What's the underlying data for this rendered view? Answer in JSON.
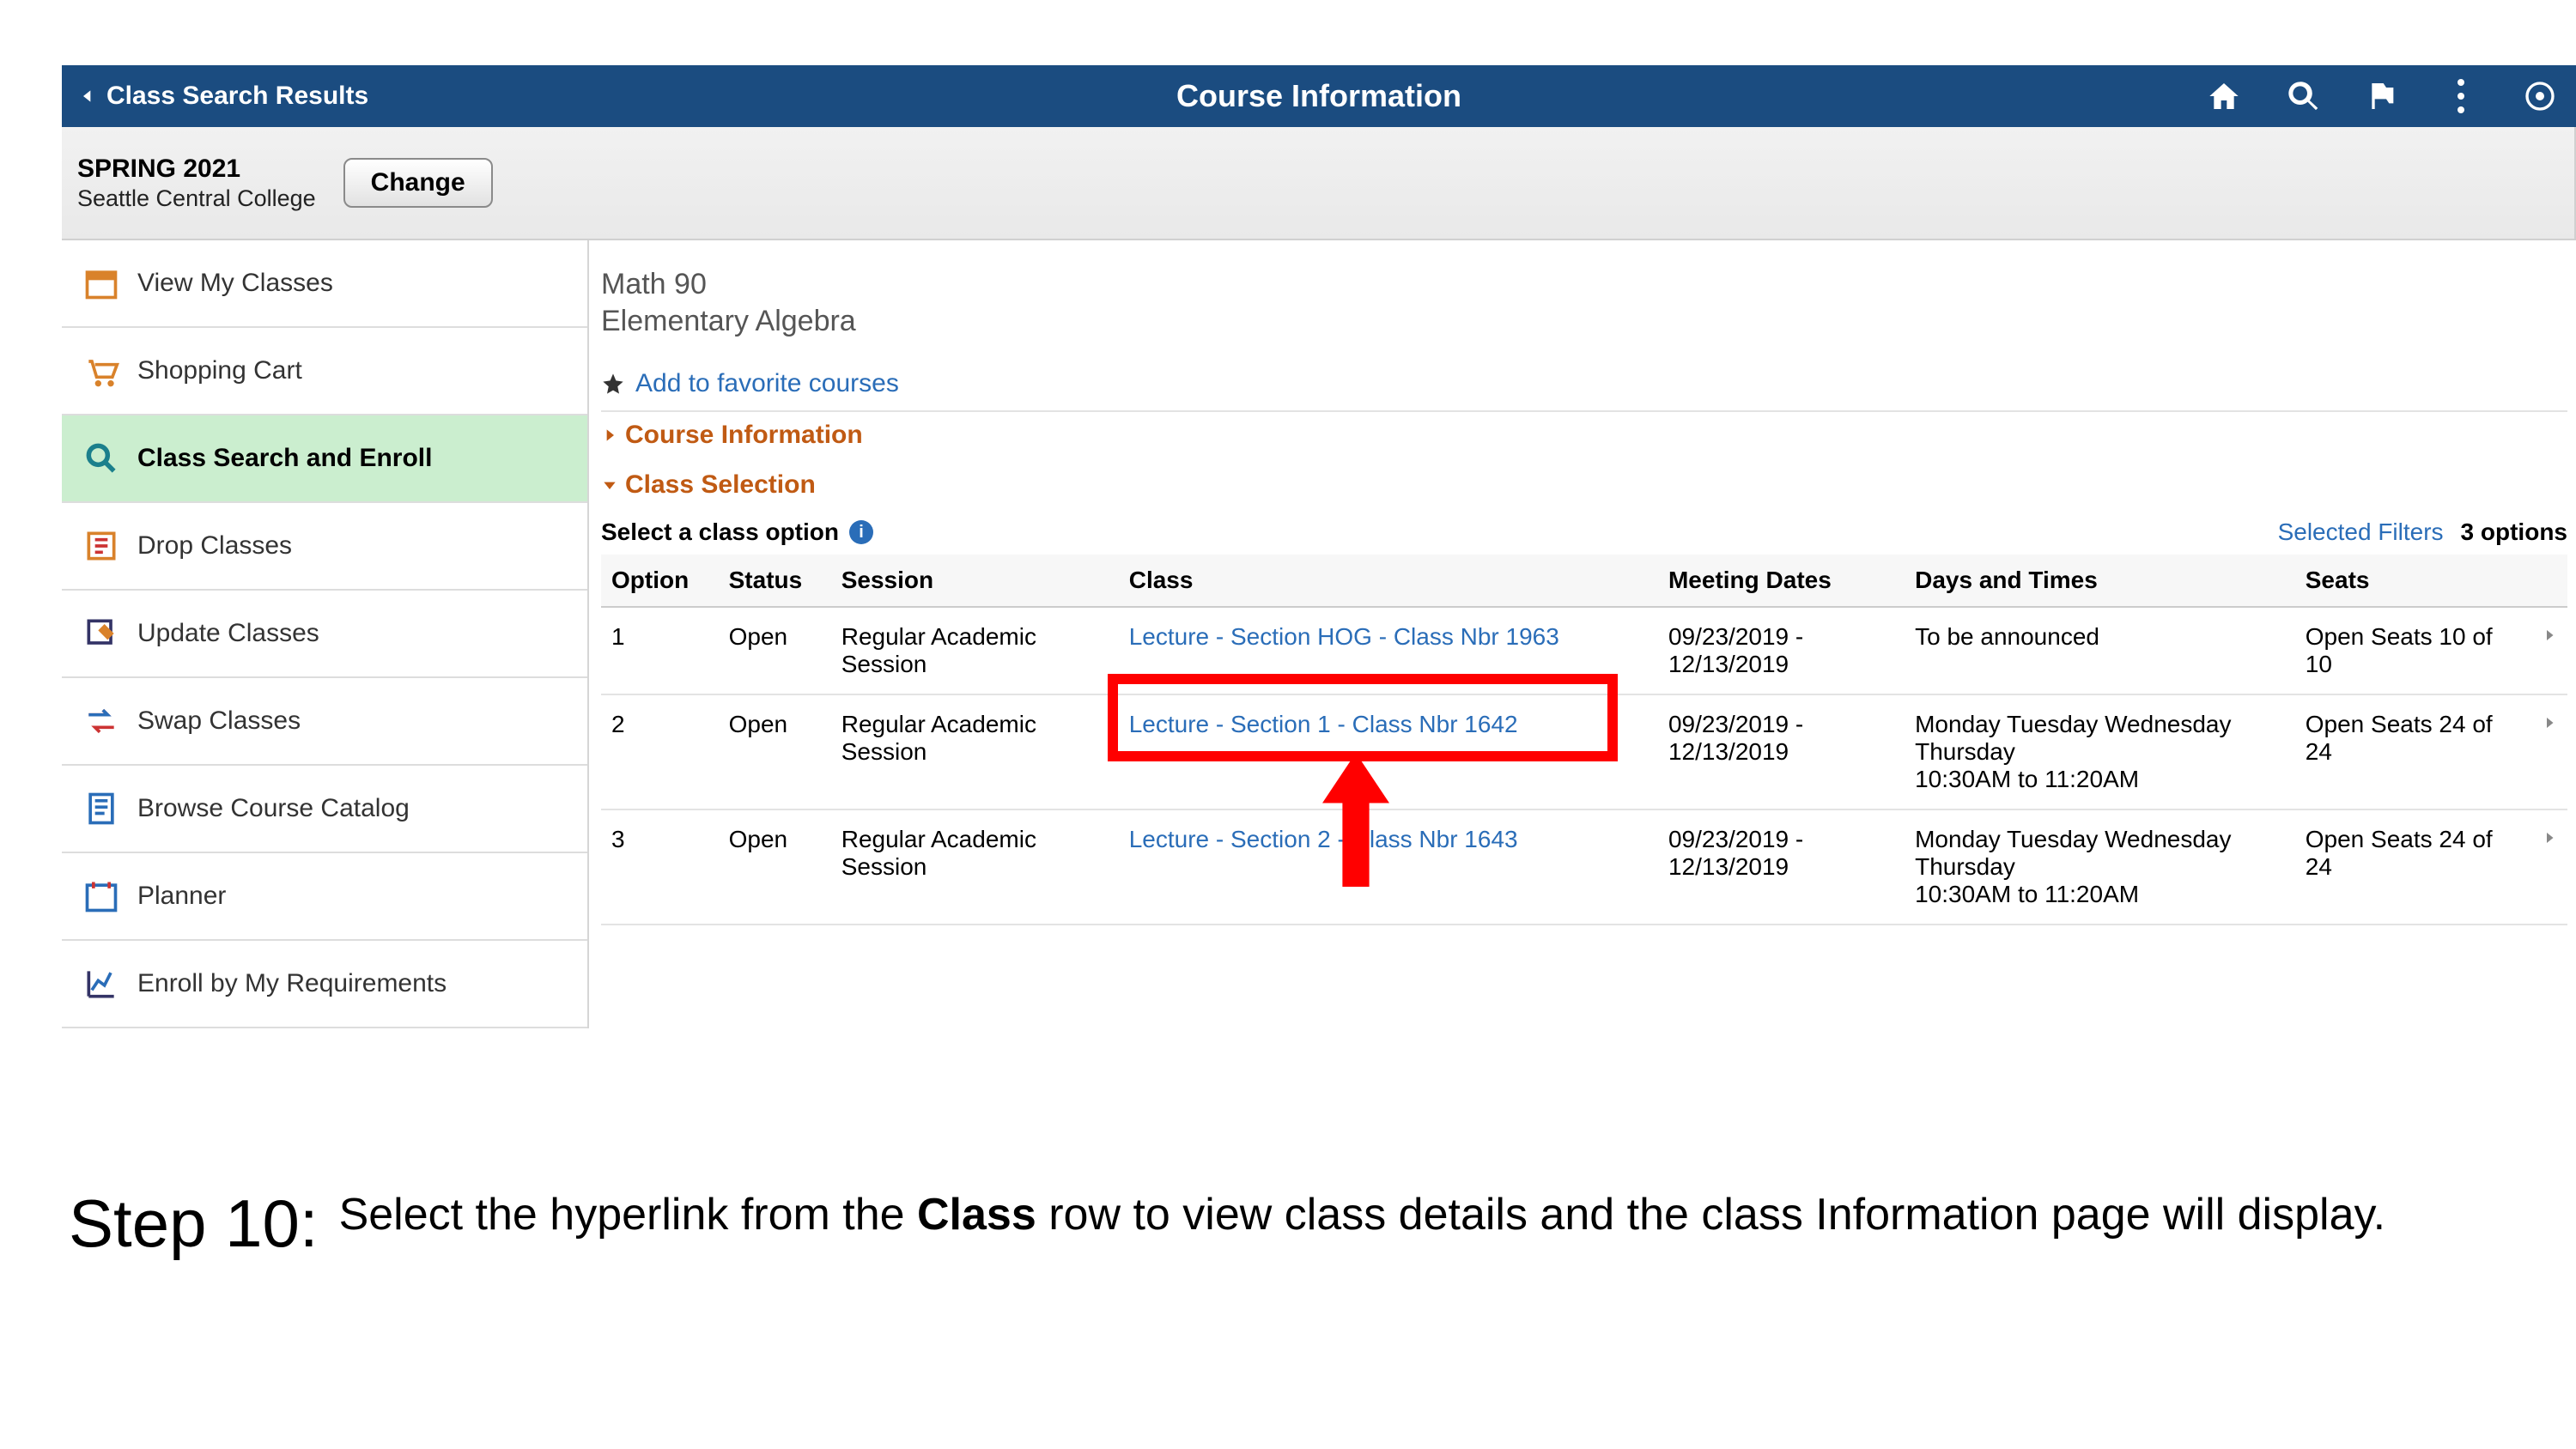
{
  "header": {
    "back_label": "Class Search Results",
    "title": "Course Information"
  },
  "term": {
    "term": "SPRING 2021",
    "institution": "Seattle Central College",
    "change_label": "Change"
  },
  "sidebar": {
    "items": [
      {
        "label": "View My Classes"
      },
      {
        "label": "Shopping Cart"
      },
      {
        "label": "Class Search and Enroll"
      },
      {
        "label": "Drop Classes"
      },
      {
        "label": "Update Classes"
      },
      {
        "label": "Swap Classes"
      },
      {
        "label": "Browse Course Catalog"
      },
      {
        "label": "Planner"
      },
      {
        "label": "Enroll by My Requirements"
      }
    ]
  },
  "course": {
    "code": "Math 90",
    "title": "Elementary Algebra",
    "favorite_label": "Add to favorite courses",
    "sections": {
      "course_info_label": "Course Information",
      "class_selection_label": "Class Selection"
    },
    "select_prompt": "Select a class option",
    "filters_label": "Selected Filters",
    "options_count": "3 options"
  },
  "table": {
    "headers": {
      "option": "Option",
      "status": "Status",
      "session": "Session",
      "class": "Class",
      "dates": "Meeting Dates",
      "times": "Days and Times",
      "seats": "Seats"
    },
    "rows": [
      {
        "option": "1",
        "status": "Open",
        "session": "Regular Academic Session",
        "class": "Lecture - Section HOG - Class Nbr 1963",
        "dates": "09/23/2019 - 12/13/2019",
        "times": "To be announced",
        "seats": "Open Seats 10 of 10"
      },
      {
        "option": "2",
        "status": "Open",
        "session": "Regular Academic Session",
        "class": "Lecture - Section 1 - Class Nbr 1642",
        "dates": "09/23/2019 - 12/13/2019",
        "times": "Monday Tuesday Wednesday Thursday\n10:30AM to 11:20AM",
        "seats": "Open Seats 24 of 24"
      },
      {
        "option": "3",
        "status": "Open",
        "session": "Regular Academic Session",
        "class": "Lecture - Section 2 - Class Nbr 1643",
        "dates": "09/23/2019 - 12/13/2019",
        "times": "Monday Tuesday Wednesday Thursday\n10:30AM to 11:20AM",
        "seats": "Open Seats 24 of 24"
      }
    ]
  },
  "caption": {
    "step": "Step 10:",
    "text_before": "Select the hyperlink from the ",
    "text_bold": "Class",
    "text_after": " row to view class details and the class Information page will display."
  }
}
